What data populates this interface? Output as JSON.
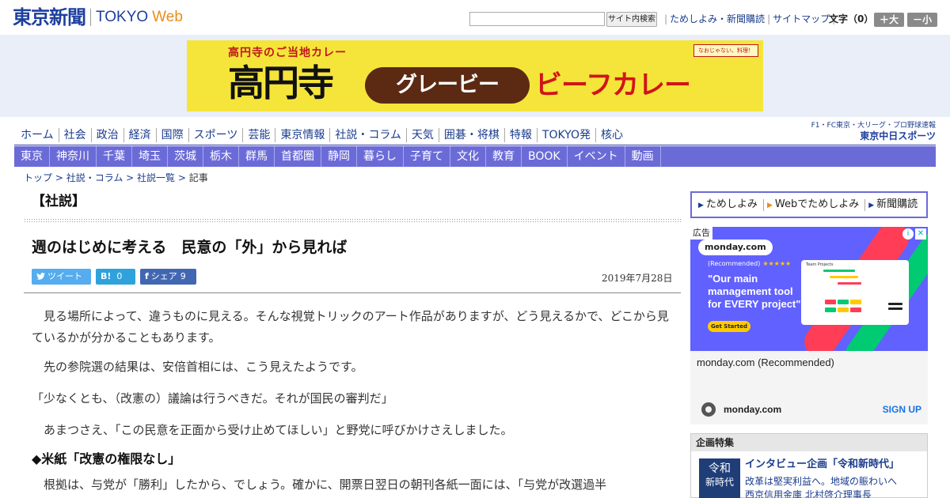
{
  "header": {
    "logo_main": "東京新聞",
    "logo_tokyo": "TOKYO",
    "logo_web": "Web",
    "search_placeholder": "",
    "search_button": "サイト内検索",
    "links": [
      "ためしよみ・新聞購読",
      "サイトマップ"
    ],
    "font_size_label": "文字（0）",
    "font_bigger": "＋大",
    "font_smaller": "－小"
  },
  "banner": {
    "subtitle": "高円寺のご当地カレー",
    "kanji": "高円寺",
    "gravy": "グレービー",
    "beef": "ビーフカレー",
    "badge": "なおじゃない、料理！"
  },
  "nav_primary": [
    "ホーム",
    "社会",
    "政治",
    "経済",
    "国際",
    "スポーツ",
    "芸能",
    "東京情報",
    "社説・コラム",
    "天気",
    "囲碁・将棋",
    "特報",
    "TOKYO発",
    "核心"
  ],
  "sports_link": {
    "text": "F1・FC東京・大リーグ・プロ野球速報",
    "brand": "東京中日スポーツ"
  },
  "nav_secondary": [
    "東京",
    "神奈川",
    "千葉",
    "埼玉",
    "茨城",
    "栃木",
    "群馬",
    "首都圏",
    "静岡",
    "暮らし",
    "子育て",
    "文化",
    "教育",
    "BOOK",
    "イベント",
    "動画"
  ],
  "breadcrumb": {
    "items": [
      "トップ",
      "社説・コラム",
      "社説一覧"
    ],
    "separator": " > ",
    "current": "記事"
  },
  "article": {
    "section": "【社説】",
    "title": "週のはじめに考える　民意の「外」から見れば",
    "share": {
      "tweet_label": "ツイート",
      "hatena_icon": "B!",
      "hatena_count": "0",
      "fb_icon": "f",
      "fb_label": "シェア",
      "fb_count": "9"
    },
    "date": "2019年7月28日",
    "paragraphs": [
      "見る場所によって、違うものに見える。そんな視覚トリックのアート作品がありますが、どう見えるかで、どこから見ているかが分かることもあります。",
      "先の参院選の結果は、安倍首相には、こう見えたようです。",
      "「少なくとも、（改憲の）議論は行うべきだ。それが国民の審判だ」",
      "あまつさえ、「この民意を正面から受け止めてほしい」と野党に呼びかけさえしました。"
    ],
    "subhead": "◆米紙「改憲の権限なし」",
    "paragraph_last": "根拠は、与党が「勝利」したから、でしょう。確かに、開票日翌日の朝刊各紙一面には、「与党が改選過半"
  },
  "sidebar": {
    "tame": [
      "ためしよみ",
      "Webでためしよみ",
      "新聞購読"
    ],
    "ad": {
      "label": "広告",
      "brand": "monday.com",
      "rec": "(Recommended)",
      "stars": "★★★★★",
      "headline": "\"Our main management tool for EVERY project\"",
      "cta": "Get Started",
      "card_title": "Team Projects",
      "title": "monday.com (Recommended)",
      "footer_name": "monday.com",
      "signup": "SIGN UP",
      "close": "✕",
      "info": "i"
    },
    "feature": {
      "heading": "企画特集",
      "thumb_line1": "令和",
      "thumb_line2": "新時代",
      "title": "インタビュー企画「令和新時代」",
      "desc1": "改革は堅実利益へ。地域の賑わいへ",
      "desc2": "西京信用金庫 北村啓介理事長"
    }
  },
  "colors": {
    "brand_blue": "#1d3f9e",
    "nav_purple": "#6b6bd8",
    "web_orange": "#e98c1a",
    "twitter": "#55acee",
    "hatena": "#2fa2dc",
    "facebook": "#4267b2"
  }
}
